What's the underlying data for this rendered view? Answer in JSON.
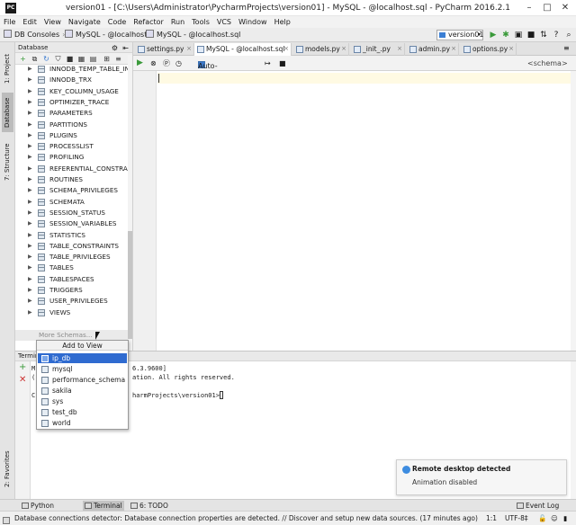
{
  "window": {
    "title": "version01 - [C:\\Users\\Administrator\\PycharmProjects\\version01] - MySQL - @localhost.sql - PyCharm 2016.2.1"
  },
  "menu": [
    "File",
    "Edit",
    "View",
    "Navigate",
    "Code",
    "Refactor",
    "Run",
    "Tools",
    "VCS",
    "Window",
    "Help"
  ],
  "breadcrumbs": {
    "a": "DB Consoles",
    "b": "MySQL - @localhost",
    "c": "MySQL - @localhost.sql"
  },
  "run_config": "version01",
  "side_tabs": {
    "project": "1: Project",
    "database": "Database",
    "structure": "7: Structure",
    "favorites": "2: Favorites"
  },
  "db_panel": {
    "title": "Database",
    "tree": [
      "INNODB_TEMP_TABLE_INFO",
      "INNODB_TRX",
      "KEY_COLUMN_USAGE",
      "OPTIMIZER_TRACE",
      "PARAMETERS",
      "PARTITIONS",
      "PLUGINS",
      "PROCESSLIST",
      "PROFILING",
      "REFERENTIAL_CONSTRAINTS",
      "ROUTINES",
      "SCHEMA_PRIVILEGES",
      "SCHEMATA",
      "SESSION_STATUS",
      "SESSION_VARIABLES",
      "STATISTICS",
      "TABLE_CONSTRAINTS",
      "TABLE_PRIVILEGES",
      "TABLES",
      "TABLESPACES",
      "TRIGGERS",
      "USER_PRIVILEGES",
      "VIEWS"
    ],
    "more": "More Schemas..."
  },
  "tabs": [
    {
      "label": "settings.py"
    },
    {
      "label": "MySQL - @localhost.sql"
    },
    {
      "label": "models.py"
    },
    {
      "label": "_init_.py"
    },
    {
      "label": "admin.py"
    },
    {
      "label": "options.py"
    }
  ],
  "editor_toolbar": {
    "autocommit": "Auto-commit",
    "schema": "<schema>"
  },
  "popup": {
    "title": "Add to View",
    "items": [
      "ip_db",
      "mysql",
      "performance_schema",
      "sakila",
      "sys",
      "test_db",
      "world"
    ],
    "selected": "ip_db"
  },
  "terminal": {
    "title": "Terminal",
    "lines": [
      {
        "left": "M",
        "right": "6.3.9600]"
      },
      {
        "left": "(",
        "right": "ation. All rights reserved."
      },
      {
        "left": "C",
        "right": "harmProjects\\version01>"
      }
    ]
  },
  "notification": {
    "title": "Remote desktop detected",
    "body": "Animation disabled"
  },
  "bottom_tabs": {
    "python_console": "Python Console",
    "terminal": "Terminal",
    "todo": "6: TODO",
    "event_log": "Event Log"
  },
  "status": {
    "message": "Database connections detector: Database connection properties are detected. // Discover and setup new data sources. (17 minutes ago)",
    "position": "1:1",
    "encoding": "UTF-8‡"
  },
  "colors": {
    "selection": "#2f6bd0",
    "run_green": "#3a9a3a",
    "active_tab": "#ffffff"
  }
}
